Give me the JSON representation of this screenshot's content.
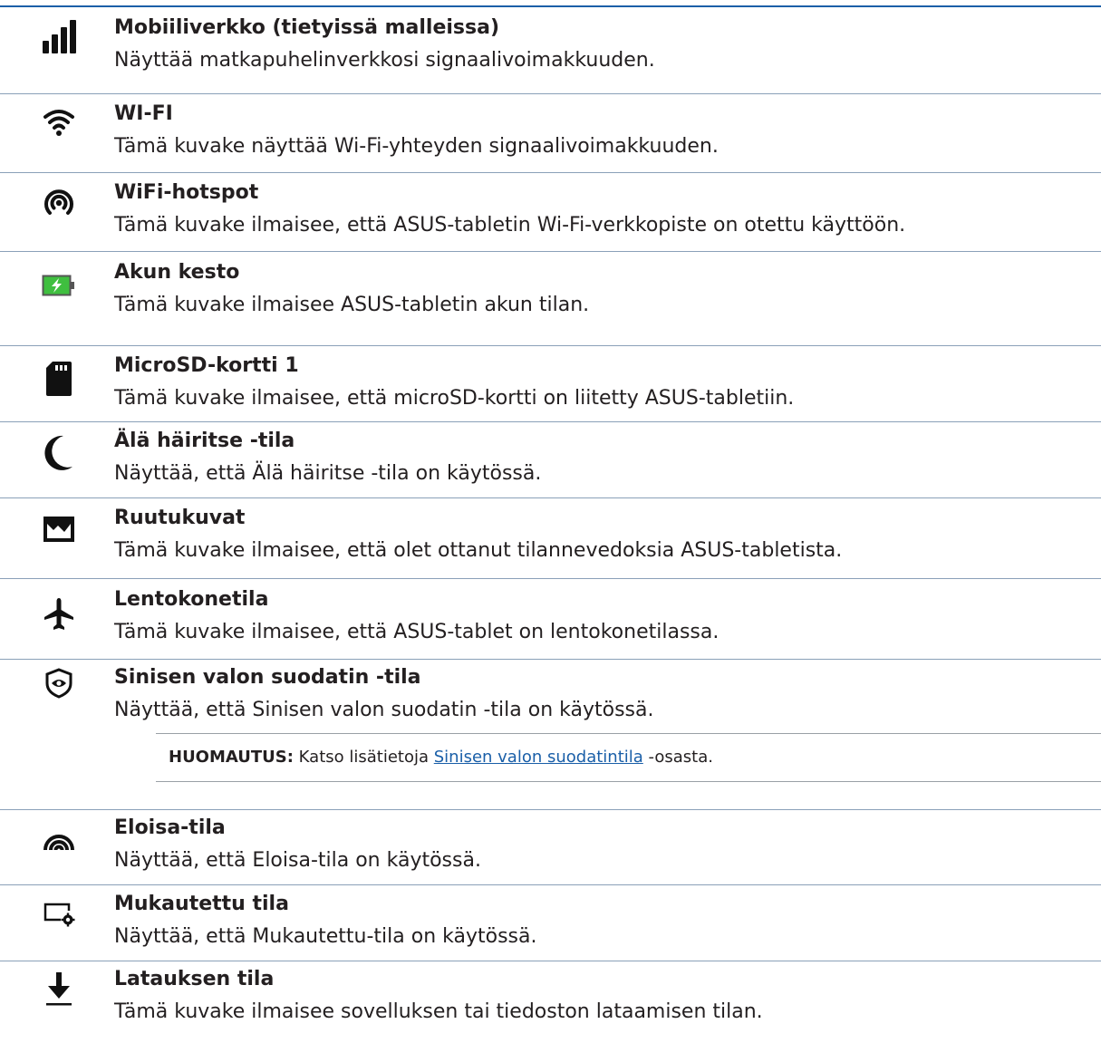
{
  "items": [
    {
      "icon": "cellular-signal-icon",
      "title": "Mobiiliverkko (tietyissä malleissa)",
      "desc": "Näyttää matkapuhelinverkkosi signaalivoimakkuuden."
    },
    {
      "icon": "wifi-icon",
      "title": "WI-FI",
      "desc": "Tämä kuvake näyttää Wi-Fi-yhteyden signaalivoimakkuuden."
    },
    {
      "icon": "hotspot-icon",
      "title": "WiFi-hotspot",
      "desc": "Tämä kuvake ilmaisee, että ASUS-tabletin Wi-Fi-verkkopiste on otettu käyttöön."
    },
    {
      "icon": "battery-charging-icon",
      "title": "Akun kesto",
      "desc": "Tämä kuvake ilmaisee ASUS-tabletin akun tilan."
    },
    {
      "icon": "sd-card-icon",
      "title": "MicroSD-kortti 1",
      "desc": "Tämä kuvake ilmaisee, että microSD-kortti on liitetty ASUS-tabletiin."
    },
    {
      "icon": "moon-icon",
      "title": "Älä häiritse -tila",
      "desc": "Näyttää, että Älä häiritse -tila on käytössä."
    },
    {
      "icon": "screenshot-image-icon",
      "title": "Ruutukuvat",
      "desc": "Tämä kuvake ilmaisee, että olet ottanut tilannevedoksia ASUS-tabletista."
    },
    {
      "icon": "airplane-icon",
      "title": "Lentokonetila",
      "desc": "Tämä kuvake ilmaisee, että ASUS-tablet on lentokonetilassa."
    },
    {
      "icon": "eye-shield-icon",
      "title": "Sinisen valon suodatin -tila",
      "desc": "Näyttää, että Sinisen valon suodatin -tila on käytössä."
    },
    {
      "icon": "vivid-mode-icon",
      "title": "Eloisa-tila",
      "desc": "Näyttää, että Eloisa-tila on käytössä."
    },
    {
      "icon": "custom-mode-icon",
      "title": "Mukautettu tila",
      "desc": "Näyttää, että Mukautettu-tila on käytössä."
    },
    {
      "icon": "download-icon",
      "title": "Latauksen tila",
      "desc": "Tämä kuvake ilmaisee sovelluksen tai tiedoston lataamisen tilan."
    }
  ],
  "note": {
    "label": "HUOMAUTUS:",
    "text_before": " Katso lisätietoja ",
    "link": "Sinisen valon suodatintila",
    "text_after": " -osasta."
  },
  "colors": {
    "rule": "#1c5fa8",
    "text": "#231f20",
    "link": "#1a5fa8",
    "battery": "#3fbf3f"
  }
}
